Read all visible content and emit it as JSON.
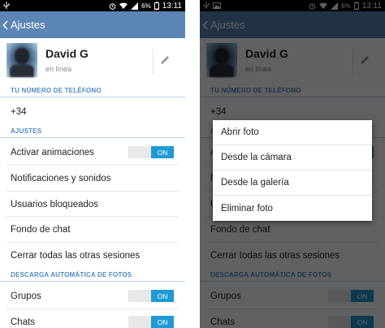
{
  "status_bar": {
    "battery_percent": "6%",
    "time": "13:11"
  },
  "action_bar": {
    "title": "Ajustes"
  },
  "profile": {
    "name": "David G",
    "status": "en línea"
  },
  "phone_section": {
    "header": "TU NÚMERO DE TELÉFONO",
    "number": "+34"
  },
  "settings_section": {
    "header": "AJUSTES",
    "items": [
      "Activar animaciones",
      "Notificaciones y sonidos",
      "Usuarios bloqueados",
      "Fondo de chat",
      "Cerrar todas las otras sesiones"
    ],
    "animations_toggle": "ON"
  },
  "download_section": {
    "header": "DESCARGA AUTOMÁTICA DE FOTOS",
    "items": [
      "Grupos",
      "Chats"
    ],
    "groups_toggle": "ON",
    "chats_toggle": "ON"
  },
  "photo_menu": {
    "items": [
      "Abrir foto",
      "Desde la cámara",
      "Desde la galería",
      "Eliminar foto"
    ]
  },
  "colors": {
    "action_bar": "#5b85b5",
    "section_header": "#4e8ac4",
    "toggle_on": "#1f9ad6"
  }
}
